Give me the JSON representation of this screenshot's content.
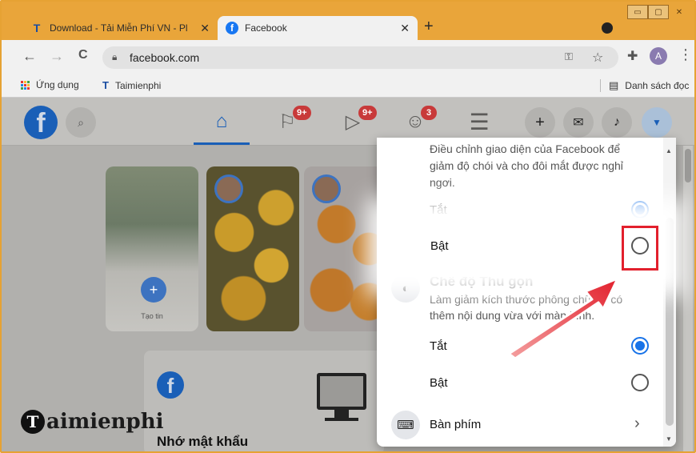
{
  "browser": {
    "tabs": [
      {
        "icon": "T",
        "title": "Download - Tải Miễn Phí VN - Pl",
        "close": "✕"
      },
      {
        "icon": "f",
        "title": "Facebook",
        "close": "✕"
      }
    ],
    "new_tab": "+",
    "window_controls": [
      "▭",
      "▢",
      "✕"
    ],
    "nav": {
      "back": "←",
      "forward": "→",
      "reload": "C"
    },
    "url": "facebook.com",
    "avatar_letter": "A",
    "menu": "⋮",
    "colors": {
      "frame": "#e9a53a",
      "toolbar": "#f1f1f1"
    }
  },
  "bookmarks": {
    "apps_label": "Ứng dụng",
    "site_icon": "T",
    "site_label": "Taimienphi",
    "reading_list": "Danh sách đọc"
  },
  "fb": {
    "logo": "f",
    "badges": {
      "pages": "9+",
      "watch": "9+",
      "groups": "3"
    },
    "create": "+",
    "stories": {
      "create_label": "Tạo tin",
      "add": "+"
    },
    "card": {
      "title": "Nhớ mật khẩu"
    },
    "colors": {
      "brand": "#1a5fb7",
      "badge": "#c83a3a"
    }
  },
  "panel": {
    "dark_mode_desc": "Điều chỉnh giao diện của Facebook để giảm độ chói và cho đôi mắt được nghỉ ngơi.",
    "dark_off": "Tắt",
    "dark_on": "Bật",
    "compact_title": "Chế độ Thu gọn",
    "compact_desc": "Làm giảm kích thước phông chữ để có thêm nội dung vừa với màn hình.",
    "compact_off": "Tắt",
    "compact_on": "Bật",
    "keyboard": "Bàn phím",
    "chevron": "›",
    "colors": {
      "radio_on": "#1873e8"
    }
  },
  "annotation": {
    "box_color": "#e2202d"
  },
  "watermark": {
    "letter": "T",
    "text": "aimienphi"
  }
}
